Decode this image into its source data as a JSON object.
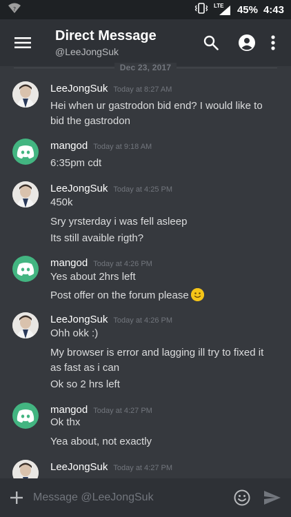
{
  "status_bar": {
    "lte": "LTE",
    "battery": "45%",
    "time": "4:43"
  },
  "header": {
    "title": "Direct Message",
    "subtitle": "@LeeJongSuk"
  },
  "date_divider": "Dec 23, 2017",
  "messages": [
    {
      "author": "LeeJongSuk",
      "time": "Today at 8:27 AM",
      "avatar": "photo",
      "lines": [
        "Hei when ur gastrodon bid end? I would like to",
        "bid the gastrodon"
      ]
    },
    {
      "author": "mangod",
      "time": "Today at 9:18 AM",
      "avatar": "discord",
      "lines": [
        "6:35pm cdt"
      ]
    },
    {
      "author": "LeeJongSuk",
      "time": "Today at 4:25 PM",
      "avatar": "photo",
      "lines": [
        "450k",
        "Sry yrsterday i was fell asleep",
        "Its still avaible rigth?"
      ]
    },
    {
      "author": "mangod",
      "time": "Today at 4:26 PM",
      "avatar": "discord",
      "lines": [
        "Yes about 2hrs left",
        "Post offer on the forum please"
      ]
    },
    {
      "author": "LeeJongSuk",
      "time": "Today at 4:26 PM",
      "avatar": "photo",
      "lines": [
        "Ohh okk :)",
        "My browser is error and lagging ill try to fixed it",
        "as fast as i can",
        "Ok so 2 hrs left"
      ]
    },
    {
      "author": "mangod",
      "time": "Today at 4:27 PM",
      "avatar": "discord",
      "lines": [
        "Ok thx",
        "Yea about, not exactly"
      ]
    },
    {
      "author": "LeeJongSuk",
      "time": "Today at 4:27 PM",
      "avatar": "photo",
      "lines": []
    }
  ],
  "input": {
    "placeholder": "Message @LeeJongSuk"
  },
  "icons": {
    "menu": "hamburger-menu-icon",
    "search": "search-icon",
    "profile": "account-circle-icon",
    "more": "more-vertical-icon",
    "add": "plus-icon",
    "emoji": "emoji-smile-icon",
    "send": "send-icon"
  },
  "colors": {
    "background": "#36393e",
    "header": "#2e3136",
    "discord_green": "#43b581",
    "username": "#ffffff",
    "timestamp": "#72767d"
  }
}
